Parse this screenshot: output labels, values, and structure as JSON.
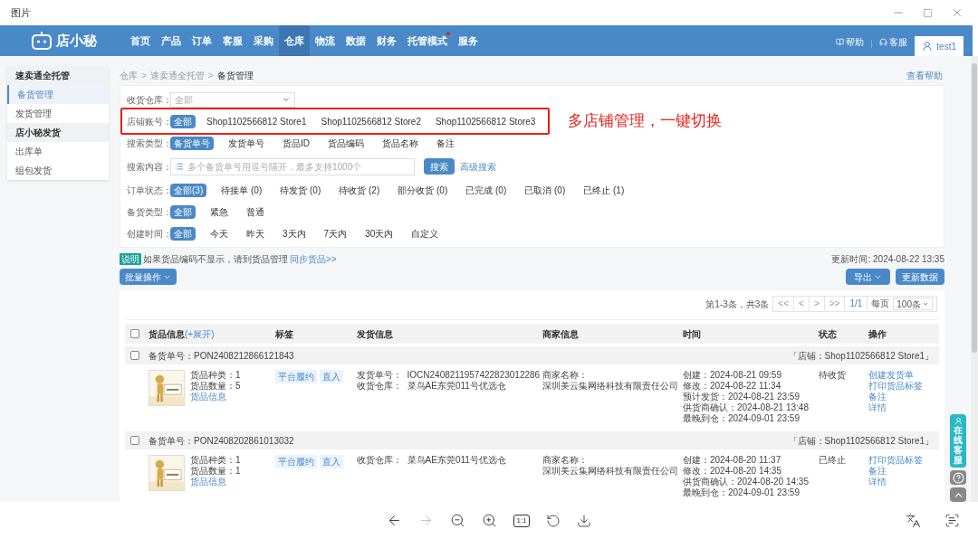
{
  "viewer": {
    "title": "图片",
    "actual_size_label": "1:1"
  },
  "nav": {
    "logo": "店小秘",
    "items": [
      {
        "label": "首页",
        "selected": false,
        "dot": false
      },
      {
        "label": "产品",
        "selected": false,
        "dot": false
      },
      {
        "label": "订单",
        "selected": false,
        "dot": false
      },
      {
        "label": "客服",
        "selected": false,
        "dot": false
      },
      {
        "label": "采购",
        "selected": false,
        "dot": false
      },
      {
        "label": "仓库",
        "selected": true,
        "dot": false
      },
      {
        "label": "物流",
        "selected": false,
        "dot": false
      },
      {
        "label": "数据",
        "selected": false,
        "dot": false
      },
      {
        "label": "财务",
        "selected": false,
        "dot": false
      },
      {
        "label": "托管模式",
        "selected": false,
        "dot": true
      },
      {
        "label": "服务",
        "selected": false,
        "dot": false
      }
    ],
    "help": "帮助",
    "service": "客服",
    "user": "test1"
  },
  "sidebar": [
    {
      "title": "速卖通全托管",
      "items": [
        {
          "label": "备货管理",
          "selected": true
        },
        {
          "label": "发货管理",
          "selected": false
        }
      ]
    },
    {
      "title": "店小秘发货",
      "items": [
        {
          "label": "出库单",
          "selected": false
        },
        {
          "label": "组包发货",
          "selected": false
        }
      ]
    }
  ],
  "breadcrumb": {
    "items": [
      "仓库",
      "速卖通全托管",
      "备货管理"
    ],
    "separator": ">"
  },
  "help_link": "查看帮助",
  "filters": [
    {
      "kind": "select",
      "label": "收货仓库：",
      "value": "全部"
    },
    {
      "kind": "options",
      "label": "店铺账号：",
      "annotation": "多店铺管理，一键切换",
      "options": [
        {
          "label": "全部",
          "selected": true
        },
        {
          "label": "Shop1102566812 Store1",
          "selected": false
        },
        {
          "label": "Shop1102566812 Store2",
          "selected": false
        },
        {
          "label": "Shop1102566812 Store3",
          "selected": false
        }
      ]
    },
    {
      "kind": "options",
      "label": "搜索类型：",
      "options": [
        {
          "label": "备货单号",
          "selected": true
        },
        {
          "label": "发货单号",
          "selected": false
        },
        {
          "label": "货品ID",
          "selected": false
        },
        {
          "label": "货品编码",
          "selected": false
        },
        {
          "label": "货品名称",
          "selected": false
        },
        {
          "label": "备注",
          "selected": false
        }
      ]
    },
    {
      "kind": "search",
      "label": "搜索内容：",
      "placeholder": "多个备货单号用逗号隔开，最多支持1000个",
      "button": "搜索",
      "link": "高级搜索"
    },
    {
      "kind": "options",
      "label": "订单状态：",
      "options": [
        {
          "label": "全部(3)",
          "selected": true
        },
        {
          "label": "待接单 (0)",
          "selected": false
        },
        {
          "label": "待发货 (0)",
          "selected": false
        },
        {
          "label": "待收货 (2)",
          "selected": false
        },
        {
          "label": "部分收货 (0)",
          "selected": false
        },
        {
          "label": "已完成 (0)",
          "selected": false
        },
        {
          "label": "已取消 (0)",
          "selected": false
        },
        {
          "label": "已终止 (1)",
          "selected": false
        }
      ]
    },
    {
      "kind": "options",
      "label": "备货类型：",
      "options": [
        {
          "label": "全部",
          "selected": true
        },
        {
          "label": "紧急",
          "selected": false
        },
        {
          "label": "普通",
          "selected": false
        }
      ]
    },
    {
      "kind": "options",
      "label": "创建时间：",
      "options": [
        {
          "label": "全部",
          "selected": true
        },
        {
          "label": "今天",
          "selected": false
        },
        {
          "label": "昨天",
          "selected": false
        },
        {
          "label": "3天内",
          "selected": false
        },
        {
          "label": "7天内",
          "selected": false
        },
        {
          "label": "30天内",
          "selected": false
        },
        {
          "label": "自定义",
          "selected": false
        }
      ]
    }
  ],
  "notice": {
    "tag": "说明",
    "text": "如果货品编码不显示，请到货品管理",
    "link": "同步货品>>"
  },
  "update_time": "更新时间: 2024-08-22 13:35",
  "batch_button": "批量操作",
  "export_button": "导出",
  "refresh_button": "更新数据",
  "pagination": {
    "summary": "第1-3条，共3条",
    "buttons": [
      "<<",
      "<",
      ">",
      ">>"
    ],
    "page": "1/1",
    "per_page_label": "每页",
    "per_page": "100条"
  },
  "table": {
    "checked": false,
    "columns": [
      {
        "label": "货品信息",
        "link": "(+展开)"
      },
      {
        "label": "标签"
      },
      {
        "label": "发货信息"
      },
      {
        "label": "商家信息"
      },
      {
        "label": "时间"
      },
      {
        "label": "状态"
      },
      {
        "label": "操作"
      }
    ],
    "orders": [
      {
        "checked": false,
        "number": "备货单号：PON2408212866121843",
        "store": "「店铺：Shop1102566812 Store1」",
        "lines": [
          "货品种类：1",
          "货品数量：5"
        ],
        "info_link": "货品信息",
        "tags": [
          "平台履约",
          "直入"
        ],
        "shipping": [
          "发货单号：  IOCN2408211957422823012286",
          "收货仓库：  菜鸟AE东莞011号优选仓"
        ],
        "merchant_label": "商家名称：",
        "merchant": "深圳美云集网络科技有限责任公司",
        "times": [
          "创建：2024-08-21 09:59",
          "修改：2024-08-22 11:34",
          "预计发货：2024-08-21 23:59",
          "供货商确认：2024-08-21 13:48",
          "最晚到仓：2024-09-01 23:59"
        ],
        "status": "待收货",
        "actions": [
          "创建发货单",
          "打印货品标签",
          "备注",
          "详情"
        ]
      },
      {
        "checked": false,
        "number": "备货单号：PON2408202861013032",
        "store": "「店铺：Shop1102566812 Store1」",
        "lines": [
          "货品种类：1",
          "货品数量：1"
        ],
        "info_link": "货品信息",
        "tags": [
          "平台履约",
          "直入"
        ],
        "shipping": [
          "收货仓库：  菜鸟AE东莞011号优选仓"
        ],
        "merchant_label": "商家名称：",
        "merchant": "深圳美云集网络科技有限责任公司",
        "times": [
          "创建：2024-08-20 11:37",
          "修改：2024-08-20 14:35",
          "供货商确认：2024-08-20 14:35",
          "最晚到仓：2024-09-01 23:59"
        ],
        "status": "已终止",
        "actions": [
          "打印货品标签",
          "备注",
          "详情"
        ]
      }
    ]
  },
  "float": {
    "service": "在线客服"
  }
}
